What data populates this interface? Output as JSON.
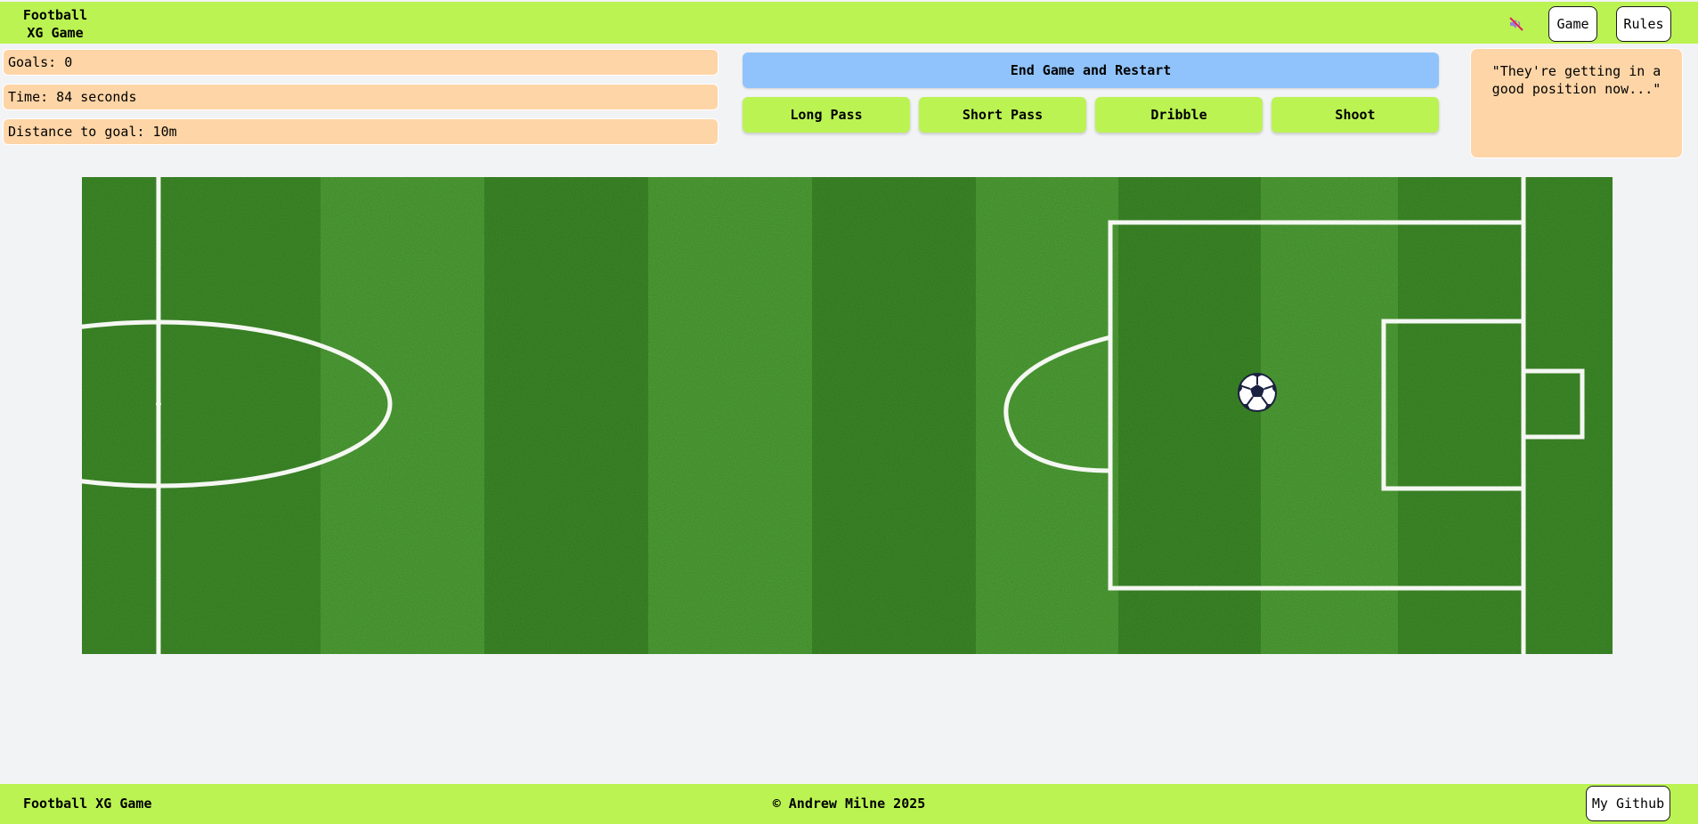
{
  "header": {
    "title": "Football\nXG Game",
    "mute_icon": "sound-muted-icon",
    "nav": [
      {
        "label": "Game"
      },
      {
        "label": "Rules"
      }
    ]
  },
  "stats": {
    "goals": "Goals: 0",
    "time": "Time: 84 seconds",
    "distance": "Distance to goal: 10m"
  },
  "controls": {
    "restart_label": "End Game and Restart",
    "actions": [
      {
        "label": "Long Pass"
      },
      {
        "label": "Short Pass"
      },
      {
        "label": "Dribble"
      },
      {
        "label": "Shoot"
      }
    ]
  },
  "commentary": {
    "text": "\"They're getting in a good position now...\""
  },
  "pitch": {
    "ball_icon": "soccer-ball-icon"
  },
  "footer": {
    "brand": "Football XG Game",
    "copyright": "© Andrew Milne 2025",
    "github_label": "My Github"
  },
  "colors": {
    "lime": "#bbf353",
    "peach": "#fed5a7",
    "blue": "#90c3fb",
    "grass_dark": "#3f8a2a",
    "grass_light": "#54a23a"
  }
}
